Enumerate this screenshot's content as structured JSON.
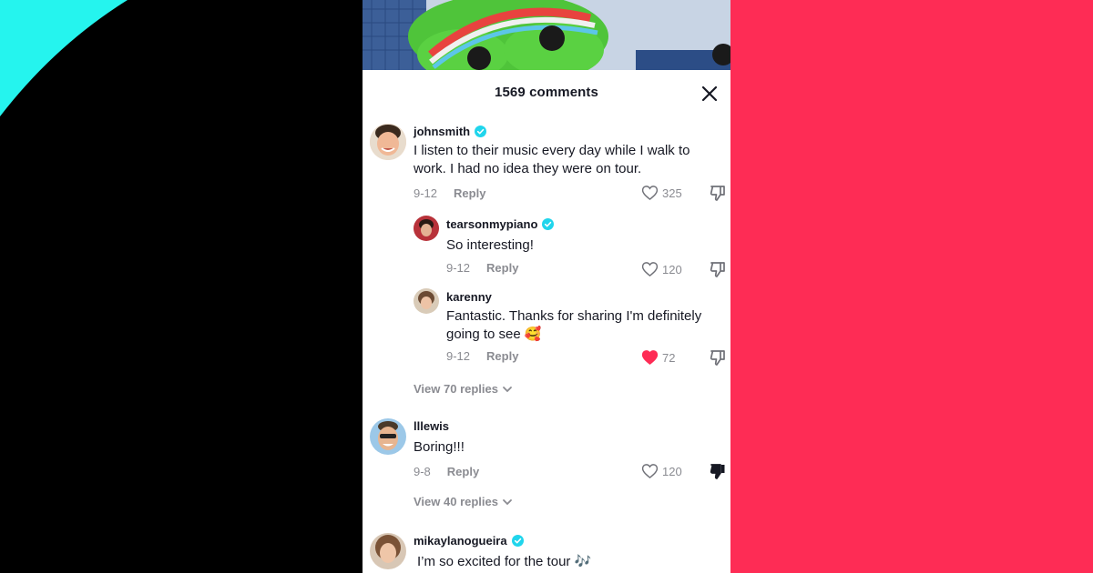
{
  "panel": {
    "comment_count": "1569",
    "comments_word": "comments"
  },
  "comments": [
    {
      "username": "johnsmith",
      "verified": true,
      "text_line1": "I listen to their music every day while I walk to",
      "text_line2": "work. I had no idea they were on tour.",
      "date": "9-12",
      "reply_label": "Reply",
      "likes": "325",
      "liked": false,
      "disliked": false
    },
    {
      "username": "tearsonmypiano",
      "verified": true,
      "text": "So interesting!",
      "date": "9-12",
      "reply_label": "Reply",
      "likes": "120",
      "liked": false,
      "disliked": false
    },
    {
      "username": "karenny",
      "verified": false,
      "text_line1": "Fantastic. Thanks for sharing I'm definitely",
      "text_line2": "going to see 🥰",
      "date": "9-12",
      "reply_label": "Reply",
      "likes": "72",
      "liked": true,
      "disliked": false
    },
    {
      "view_replies": "View 70 replies"
    },
    {
      "username": "lllewis",
      "verified": false,
      "text": "Boring!!!",
      "date": "9-8",
      "reply_label": "Reply",
      "likes": "120",
      "liked": false,
      "disliked": true
    },
    {
      "view_replies": "View 40 replies"
    },
    {
      "username": "mikaylanogueira",
      "verified": true,
      "text": "I’m so excited for the tour 🎶"
    }
  ],
  "colors": {
    "brand_red": "#fe2c55",
    "brand_cyan": "#25f4ee",
    "verified_blue": "#20d5ec",
    "text_primary": "#161823",
    "text_secondary": "#8a8b91"
  },
  "icons": [
    "close-icon",
    "verified-icon",
    "heart-icon",
    "heart-filled-icon",
    "thumbs-down-icon",
    "chevron-down-icon"
  ]
}
